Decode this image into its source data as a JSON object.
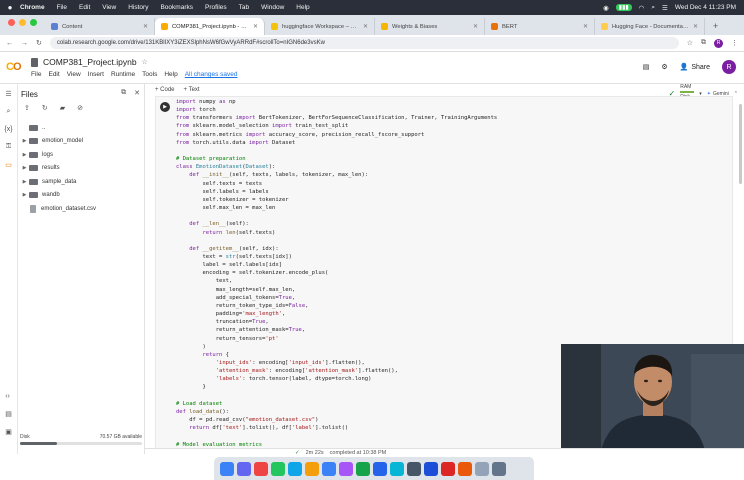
{
  "menubar": {
    "app": "Chrome",
    "items": [
      "File",
      "Edit",
      "View",
      "History",
      "Bookmarks",
      "Profiles",
      "Tab",
      "Window",
      "Help"
    ],
    "clock": "Wed Dec 4  11:23 PM"
  },
  "tabs": [
    {
      "label": "Content",
      "color": "#5b7fd3",
      "active": false
    },
    {
      "label": "COMP381_Project.ipynb - Co...",
      "color": "#f9ab00",
      "active": true
    },
    {
      "label": "huggingface Workspace – W...",
      "color": "#f4c20d",
      "active": false
    },
    {
      "label": "Weights & Biases",
      "color": "#f4b400",
      "active": false
    },
    {
      "label": "BERT",
      "color": "#e8710a",
      "active": false
    },
    {
      "label": "Hugging Face - Documentati...",
      "color": "#ffcc4d",
      "active": false
    }
  ],
  "address": {
    "url": "colab.research.google.com/drive/131KBlIXY3iZEXSlphNsW6fGwVyARRdF#scrollTo=nIGN6de3vsKw"
  },
  "colab": {
    "notebook_title": "COMP381_Project.ipynb",
    "menus": [
      "File",
      "Edit",
      "View",
      "Insert",
      "Runtime",
      "Tools",
      "Help"
    ],
    "save_status": "All changes saved",
    "share_label": "Share",
    "avatar_letter": "R",
    "add_code": "+ Code",
    "add_text": "+ Text",
    "ram_label": "RAM",
    "disk_label": "Disk",
    "gemini_label": "Gemini"
  },
  "files_panel": {
    "title": "Files",
    "items": [
      {
        "name": "..",
        "type": "folder",
        "expandable": false
      },
      {
        "name": "emotion_model",
        "type": "folder",
        "expandable": true
      },
      {
        "name": "logs",
        "type": "folder",
        "expandable": true
      },
      {
        "name": "results",
        "type": "folder",
        "expandable": true
      },
      {
        "name": "sample_data",
        "type": "folder",
        "expandable": true
      },
      {
        "name": "wandb",
        "type": "folder",
        "expandable": true
      },
      {
        "name": "emotion_dataset.csv",
        "type": "file",
        "expandable": false
      }
    ],
    "disk_label": "Disk",
    "disk_value": "70.57 GB available",
    "disk_used_fraction": 0.3
  },
  "status": {
    "elapsed": "2m 22s",
    "completed": "completed at 10:38 PM"
  },
  "dock_colors": [
    "#3b82f6",
    "#6366f1",
    "#ef4444",
    "#22c55e",
    "#0ea5e9",
    "#f59e0b",
    "#3b82f6",
    "#a855f7",
    "#16a34a",
    "#2563eb",
    "#06b6d4",
    "#475569",
    "#1d4ed8",
    "#dc2626",
    "#ea580c",
    "#94a3b8",
    "#64748b"
  ]
}
